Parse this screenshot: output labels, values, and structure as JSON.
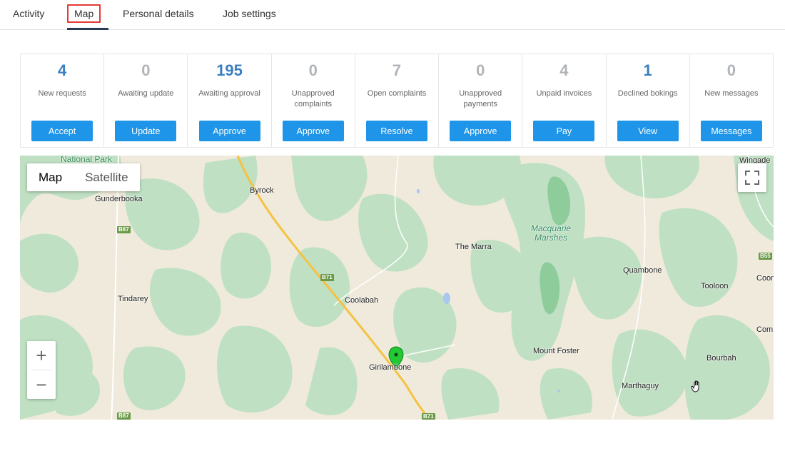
{
  "tabs": [
    {
      "label": "Activity"
    },
    {
      "label": "Map"
    },
    {
      "label": "Personal details"
    },
    {
      "label": "Job settings"
    }
  ],
  "stats": [
    {
      "value": "4",
      "label": "New requests",
      "button": "Accept"
    },
    {
      "value": "0",
      "label": "Awaiting update",
      "button": "Update"
    },
    {
      "value": "195",
      "label": "Awaiting approval",
      "button": "Approve"
    },
    {
      "value": "0",
      "label": "Unapproved complaints",
      "button": "Approve"
    },
    {
      "value": "7",
      "label": "Open complaints",
      "button": "Resolve"
    },
    {
      "value": "0",
      "label": "Unapproved payments",
      "button": "Approve"
    },
    {
      "value": "4",
      "label": "Unpaid invoices",
      "button": "Pay"
    },
    {
      "value": "1",
      "label": "Declined bokings",
      "button": "View"
    },
    {
      "value": "0",
      "label": "New messages",
      "button": "Messages"
    }
  ],
  "map": {
    "type_map": "Map",
    "type_satellite": "Satellite",
    "zoom_in": "+",
    "zoom_out": "−",
    "places": {
      "national_park": "National Park",
      "wingadee": "Wingade",
      "byrock": "Byrock",
      "gunderbooka": "Gunderbooka",
      "the_marra": "The Marra",
      "macquarie_marshes_1": "Macquarie",
      "macquarie_marshes_2": "Marshes",
      "quambone": "Quambone",
      "tooloon": "Tooloon",
      "coon": "Coon",
      "tindarey": "Tindarey",
      "coolabah": "Coolabah",
      "com": "Com",
      "mount_foster": "Mount Foster",
      "bourbah": "Bourbah",
      "girilambone": "Girilambone",
      "marthaguy": "Marthaguy"
    },
    "shields": {
      "b87_top": "B87",
      "b87_bottom": "B87",
      "b71_mid": "B71",
      "b71_bottom": "B71",
      "b55": "B55"
    }
  },
  "colors": {
    "accent_button": "#1e95e8",
    "value_blue": "#3a7ec0",
    "value_gray": "#b0b4b8",
    "active_tab_underline": "#2b3a55",
    "active_tab_outline": "#e53935",
    "map_land": "#efeadb",
    "map_green": "#bfe0c3",
    "marker": "#22c933"
  }
}
